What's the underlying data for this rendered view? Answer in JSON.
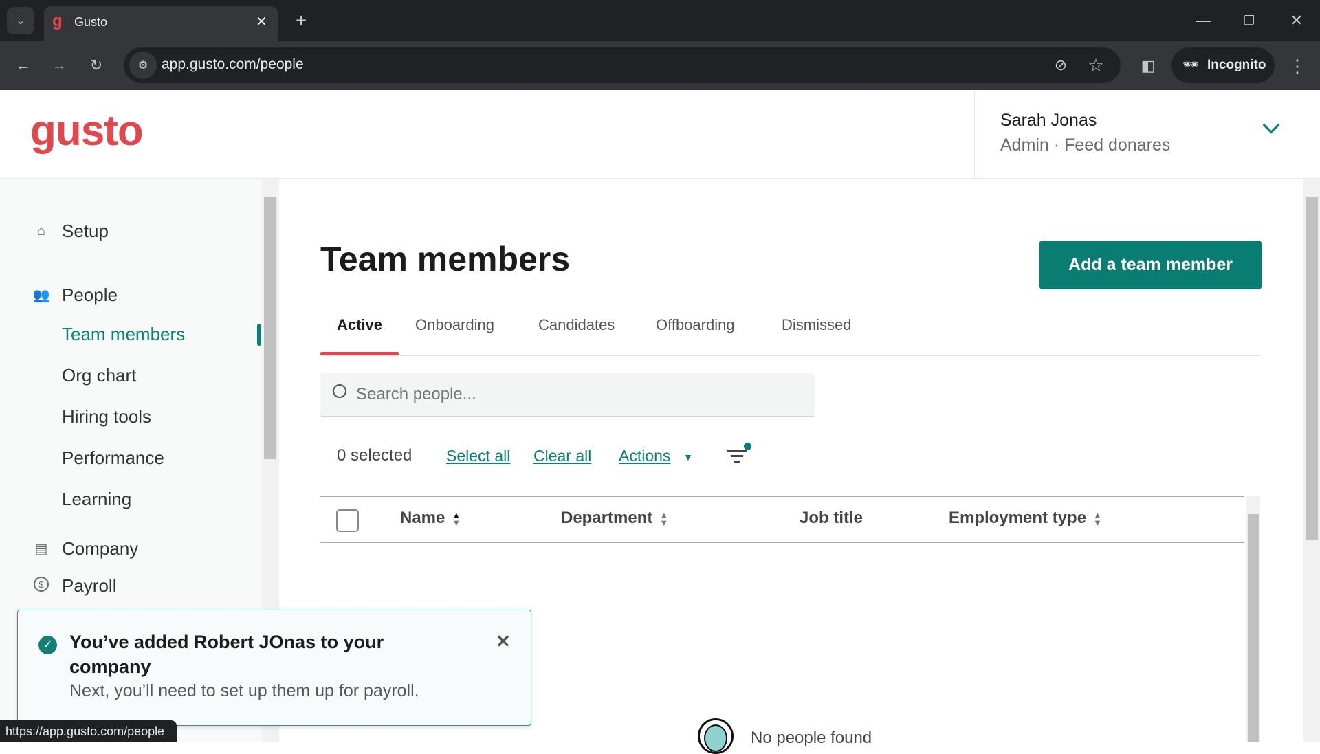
{
  "browser": {
    "tab_title": "Gusto",
    "url": "app.gusto.com/people",
    "incognito_label": "Incognito",
    "status_url": "https://app.gusto.com/people"
  },
  "header": {
    "logo": "gusto",
    "user_name": "Sarah Jonas",
    "user_role": "Admin · Feed donares"
  },
  "sidebar": {
    "items": [
      {
        "label": "Setup",
        "icon": "home-icon"
      },
      {
        "label": "People",
        "icon": "people-icon"
      },
      {
        "label": "Team members",
        "active": true
      },
      {
        "label": "Org chart"
      },
      {
        "label": "Hiring tools"
      },
      {
        "label": "Performance"
      },
      {
        "label": "Learning"
      },
      {
        "label": "Company",
        "icon": "store-icon"
      },
      {
        "label": "Payroll",
        "icon": "dollar-icon"
      }
    ]
  },
  "main": {
    "title": "Team members",
    "add_button": "Add a team member",
    "tabs": [
      {
        "label": "Active",
        "active": true
      },
      {
        "label": "Onboarding"
      },
      {
        "label": "Candidates"
      },
      {
        "label": "Offboarding"
      },
      {
        "label": "Dismissed"
      }
    ],
    "search_placeholder": "Search people...",
    "selected_count": "0 selected",
    "select_all": "Select all",
    "clear_all": "Clear all",
    "actions": "Actions",
    "columns": [
      "Name",
      "Department",
      "Job title",
      "Employment type"
    ],
    "empty_text": "No people found"
  },
  "toast": {
    "title": "You’ve added Robert JOnas to your company",
    "message": "Next, you’ll need to set up them up for payroll."
  },
  "colors": {
    "brand": "#e0484d",
    "accent": "#0a7f76",
    "tab_underline": "#e0484d"
  }
}
